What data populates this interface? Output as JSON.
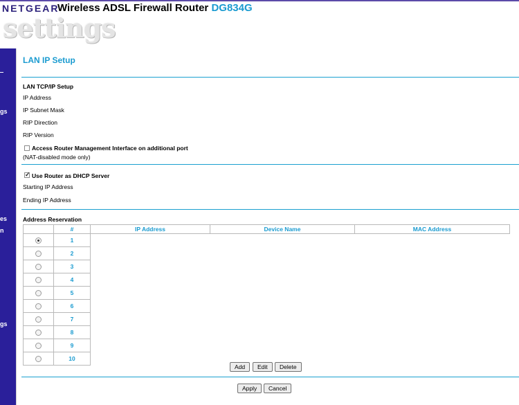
{
  "header": {
    "brand": "NETGEAR",
    "product": "Wireless ADSL Firewall Router",
    "model": "DG834G",
    "logo_text": "settings"
  },
  "sidebar": {
    "fragments": [
      "gs",
      "es",
      "n",
      "gs"
    ]
  },
  "page": {
    "title": "LAN IP Setup"
  },
  "lan": {
    "section_title": "LAN TCP/IP Setup",
    "ip_address_label": "IP Address",
    "subnet_mask_label": "IP Subnet Mask",
    "rip_direction_label": "RIP Direction",
    "rip_version_label": "RIP Version",
    "additional_port_label": "Access Router Management Interface on additional port",
    "additional_port_checked": false,
    "nat_note": "(NAT-disabled mode only)"
  },
  "dhcp": {
    "use_router_label": "Use Router as DHCP Server",
    "use_router_checked": true,
    "starting_ip_label": "Starting IP Address",
    "ending_ip_label": "Ending IP Address"
  },
  "reservation": {
    "title": "Address Reservation",
    "columns": [
      "#",
      "IP Address",
      "Device Name",
      "MAC Address"
    ],
    "rows": [
      "1",
      "2",
      "3",
      "4",
      "5",
      "6",
      "7",
      "8",
      "9",
      "10"
    ],
    "selected_row": "1",
    "add_label": "Add",
    "edit_label": "Edit",
    "delete_label": "Delete"
  },
  "footer": {
    "apply_label": "Apply",
    "cancel_label": "Cancel"
  },
  "colors": {
    "accent": "#1a9bd0",
    "nav": "#2a1f9a"
  }
}
